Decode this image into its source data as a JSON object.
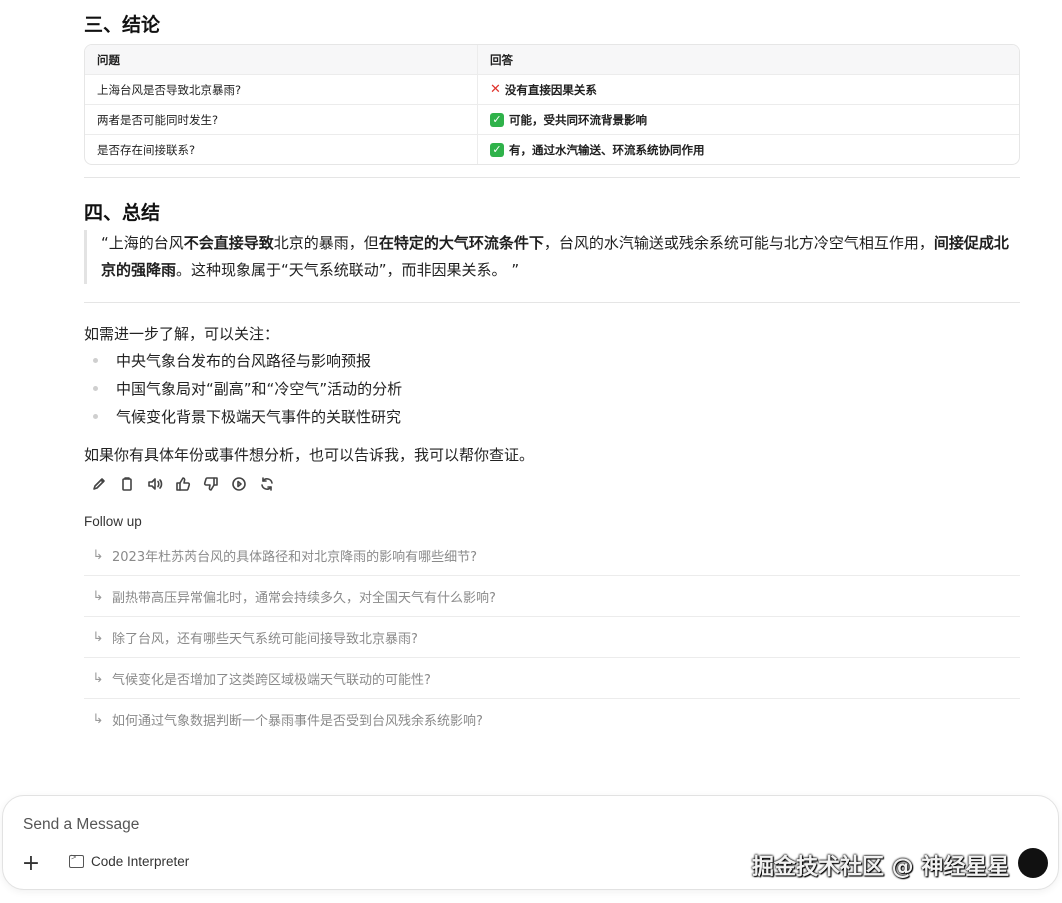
{
  "sections": {
    "conclusion_title": "三、结论",
    "summary_title": "四、总结"
  },
  "table": {
    "headers": [
      "问题",
      "回答"
    ],
    "rows": [
      {
        "q": "上海台风是否导致北京暴雨?",
        "icon": "cross-mark-icon",
        "a": "没有直接因果关系"
      },
      {
        "q": "两者是否可能同时发生?",
        "icon": "check-mark-icon",
        "a": "可能，受共同环流背景影响"
      },
      {
        "q": "是否存在间接联系?",
        "icon": "check-mark-icon",
        "a": "有，通过水汽输送、环流系统协同作用"
      }
    ]
  },
  "quote": {
    "p1": "“上海的台风",
    "b1": "不会直接导致",
    "p2": "北京的暴雨，但",
    "b2": "在特定的大气环流条件下",
    "p3": "，台风的水汽输送或残余系统可能与北方冷空气相互作用，",
    "b3": "间接促成北京的强降雨",
    "p4": "。这种现象属于“天气系统联动”，而非因果关系。 ”"
  },
  "intro": "如需进一步了解，可以关注：",
  "bullets": [
    "中央气象台发布的台风路径与影响预报",
    "中国气象局对“副高”和“冷空气”活动的分析",
    "气候变化背景下极端天气事件的关联性研究"
  ],
  "outro": "如果你有具体年份或事件想分析，也可以告诉我，我可以帮你查证。",
  "actions": [
    "edit-icon",
    "copy-icon",
    "read-aloud-icon",
    "thumbs-up-icon",
    "thumbs-down-icon",
    "continue-icon",
    "regenerate-icon"
  ],
  "followup": {
    "label": "Follow up",
    "arrow": "↳",
    "items": [
      "2023年杜苏芮台风的具体路径和对北京降雨的影响有哪些细节?",
      "副热带高压异常偏北时，通常会持续多久，对全国天气有什么影响?",
      "除了台风，还有哪些天气系统可能间接导致北京暴雨?",
      "气候变化是否增加了这类跨区域极端天气联动的可能性?",
      "如何通过气象数据判断一个暴雨事件是否受到台风残余系统影响?"
    ]
  },
  "composer": {
    "placeholder": "Send a Message",
    "plus": "+",
    "code_interpreter": "Code Interpreter"
  },
  "watermark": "掘金技术社区 @ 神经星星"
}
